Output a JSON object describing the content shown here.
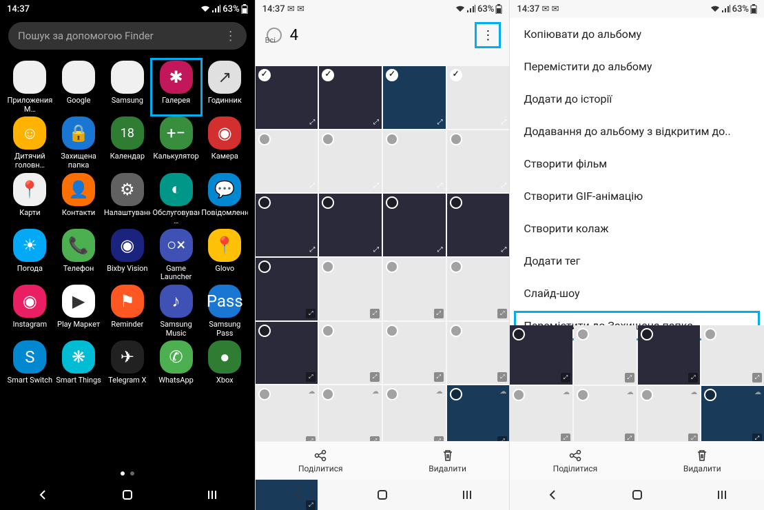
{
  "status": {
    "time": "14:37",
    "battery": "63%"
  },
  "screen1": {
    "search_placeholder": "Пошук за допомогою Finder",
    "apps": [
      {
        "label": "Приложения M…",
        "color": "#f0f0f0"
      },
      {
        "label": "Google",
        "color": "#f0f0f0"
      },
      {
        "label": "Samsung",
        "color": "#f0f0f0"
      },
      {
        "label": "Галерея",
        "color": "#c2185b",
        "highlight": true
      },
      {
        "label": "Годинник",
        "color": "#e0e0e0"
      },
      {
        "label": "Дитячий головн…",
        "color": "#ffb300"
      },
      {
        "label": "Захищена папка",
        "color": "#1976d2"
      },
      {
        "label": "Календар",
        "color": "#2e7d32"
      },
      {
        "label": "Калькулятор",
        "color": "#388e3c"
      },
      {
        "label": "Камера",
        "color": "#d32f2f"
      },
      {
        "label": "Карти",
        "color": "#f0f0f0"
      },
      {
        "label": "Контакти",
        "color": "#ff6f00"
      },
      {
        "label": "Налаштування",
        "color": "#616161"
      },
      {
        "label": "Обслуговування …",
        "color": "#009688"
      },
      {
        "label": "Повідомлення",
        "color": "#0288d1"
      },
      {
        "label": "Погода",
        "color": "#03a9f4"
      },
      {
        "label": "Телефон",
        "color": "#4caf50"
      },
      {
        "label": "Bixby Vision",
        "color": "#1a237e"
      },
      {
        "label": "Game Launcher",
        "color": "#3f51b5"
      },
      {
        "label": "Glovo",
        "color": "#ffc107"
      },
      {
        "label": "Instagram",
        "color": "#e91e63"
      },
      {
        "label": "Play Маркет",
        "color": "#fff"
      },
      {
        "label": "Reminder",
        "color": "#ff5722"
      },
      {
        "label": "Samsung Music",
        "color": "#3f51b5"
      },
      {
        "label": "Samsung Pass",
        "color": "#1976d2"
      },
      {
        "label": "Smart Switch",
        "color": "#0288d1"
      },
      {
        "label": "Smart Things",
        "color": "#00bcd4"
      },
      {
        "label": "Telegram X",
        "color": "#212121"
      },
      {
        "label": "WhatsApp",
        "color": "#4caf50"
      },
      {
        "label": "Xbox",
        "color": "#2e7d32"
      }
    ]
  },
  "screen2": {
    "select_all": "Всі",
    "count": "4",
    "share": "Поділитися",
    "delete": "Видалити"
  },
  "screen3": {
    "menu": [
      "Копіювати до альбому",
      "Перемістити до альбому",
      "Додати до історії",
      "Додавання до альбому з відкритим до..",
      "Створити фільм",
      "Створити GIF-анімацію",
      "Створити колаж",
      "Додати тег",
      "Слайд-шоу",
      "Перемістити до Захищена папка"
    ],
    "highlight_index": 9,
    "share": "Поділитися",
    "delete": "Видалити"
  }
}
